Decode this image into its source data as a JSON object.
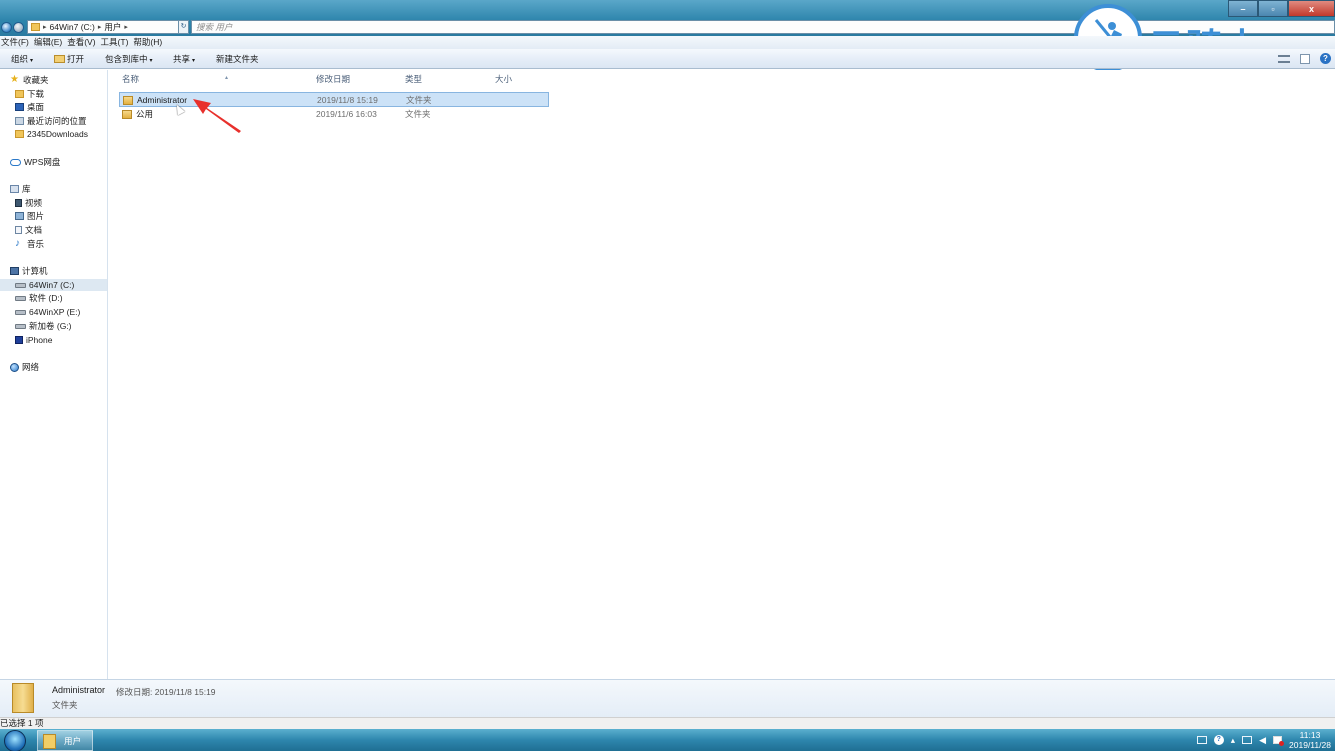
{
  "address": {
    "segments": [
      "64Win7 (C:)",
      "用户"
    ],
    "search_placeholder": "搜索 用户"
  },
  "window_buttons": {
    "minimize": "–",
    "maximize": "▫",
    "close": "x"
  },
  "watermark": {
    "text": "云骑士"
  },
  "menu": [
    "文件(F)",
    "编辑(E)",
    "查看(V)",
    "工具(T)",
    "帮助(H)"
  ],
  "toolbar": {
    "organize": "组织",
    "open": "打开",
    "include_in_library": "包含到库中",
    "share": "共享",
    "new_folder": "新建文件夹"
  },
  "nav": {
    "favorites": "收藏夹",
    "downloads": "下载",
    "desktop": "桌面",
    "recent": "最近访问的位置",
    "downloads2345": "2345Downloads",
    "wps": "WPS网盘",
    "libraries": "库",
    "videos": "视频",
    "pictures": "图片",
    "documents": "文档",
    "music": "音乐",
    "computer": "计算机",
    "drive_c": "64Win7  (C:)",
    "drive_d": "软件 (D:)",
    "drive_e": "64WinXP  (E:)",
    "drive_g": "新加卷 (G:)",
    "iphone": "iPhone",
    "network": "网络"
  },
  "columns": {
    "name": "名称",
    "modified": "修改日期",
    "type": "类型",
    "size": "大小"
  },
  "files": [
    {
      "name": "Administrator",
      "modified": "2019/11/8 15:19",
      "type": "文件夹",
      "selected": true
    },
    {
      "name": "公用",
      "modified": "2019/11/6 16:03",
      "type": "文件夹",
      "selected": false
    }
  ],
  "details": {
    "name": "Administrator",
    "meta": "修改日期: 2019/11/8 15:19",
    "type": "文件夹"
  },
  "status": "已选择 1 项",
  "taskbar": {
    "item_label": "用户",
    "time": "11:13",
    "date": "2019/11/28"
  },
  "colors": {
    "selection": "#cce2f7",
    "annotation_arrow": "#e8302c",
    "watermark": "#3d8fd6"
  }
}
